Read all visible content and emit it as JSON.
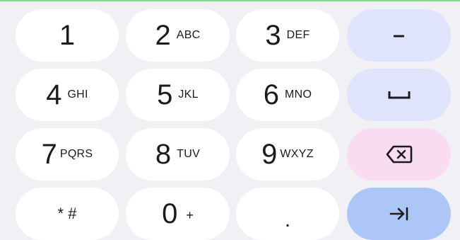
{
  "keypad": {
    "keys": [
      {
        "digit": "1",
        "letters": ""
      },
      {
        "digit": "2",
        "letters": "ABC"
      },
      {
        "digit": "3",
        "letters": "DEF"
      },
      {
        "digit": "4",
        "letters": "GHI"
      },
      {
        "digit": "5",
        "letters": "JKL"
      },
      {
        "digit": "6",
        "letters": "MNO"
      },
      {
        "digit": "7",
        "letters": "PQRS"
      },
      {
        "digit": "8",
        "letters": "TUV"
      },
      {
        "digit": "9",
        "letters": "WXYZ"
      }
    ],
    "star_hash": "* #",
    "zero": {
      "digit": "0",
      "letters": "+"
    },
    "period": ".",
    "minus": "–"
  },
  "icons": {
    "space": "space-bar-icon",
    "backspace": "backspace-icon",
    "next": "tab-next-icon"
  },
  "colors": {
    "background": "#f1f0f4",
    "key": "#ffffff",
    "function_key": "#dfe3fb",
    "backspace_key": "#fadcf2",
    "action_key": "#adc6f8",
    "top_accent": "#7ed98e"
  }
}
